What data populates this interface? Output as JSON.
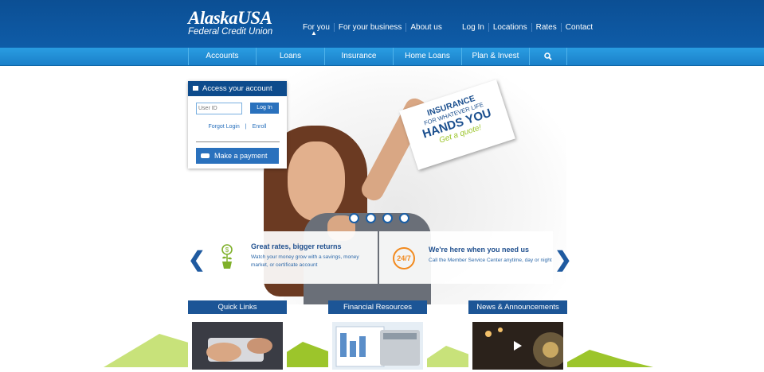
{
  "logo": {
    "main": "AlaskaUSA",
    "sub": "Federal Credit Union"
  },
  "top_nav": {
    "primary": [
      "For you",
      "For your business",
      "About us"
    ],
    "secondary": [
      "Log In",
      "Locations",
      "Rates",
      "Contact"
    ]
  },
  "main_nav": [
    "Accounts",
    "Loans",
    "Insurance",
    "Home Loans",
    "Plan & Invest"
  ],
  "login": {
    "title": "Access your account",
    "userid_placeholder": "User ID",
    "login_button": "Log In",
    "forgot_login": "Forgot Login",
    "separator": "|",
    "enroll": "Enroll",
    "payment_button": "Make a payment"
  },
  "hero_sign": {
    "line1": "INSURANCE",
    "line2": "FOR WHATEVER LIFE",
    "line3": "HANDS YOU",
    "line4": "Get a quote!"
  },
  "promos": [
    {
      "title": "Great rates, bigger returns",
      "text": "Watch your money grow with a savings, money market, or certificate account"
    },
    {
      "title": "We're here when you need us",
      "text": "Call the Member Service Center anytime, day or night",
      "icon_text": "24/7"
    }
  ],
  "cards": [
    "Quick Links",
    "Financial Resources",
    "News & Announcements"
  ],
  "colors": {
    "primary_blue": "#0d4b8c",
    "nav_blue": "#2a9de2",
    "accent_green": "#9cc52b",
    "accent_orange": "#f28a1e"
  }
}
